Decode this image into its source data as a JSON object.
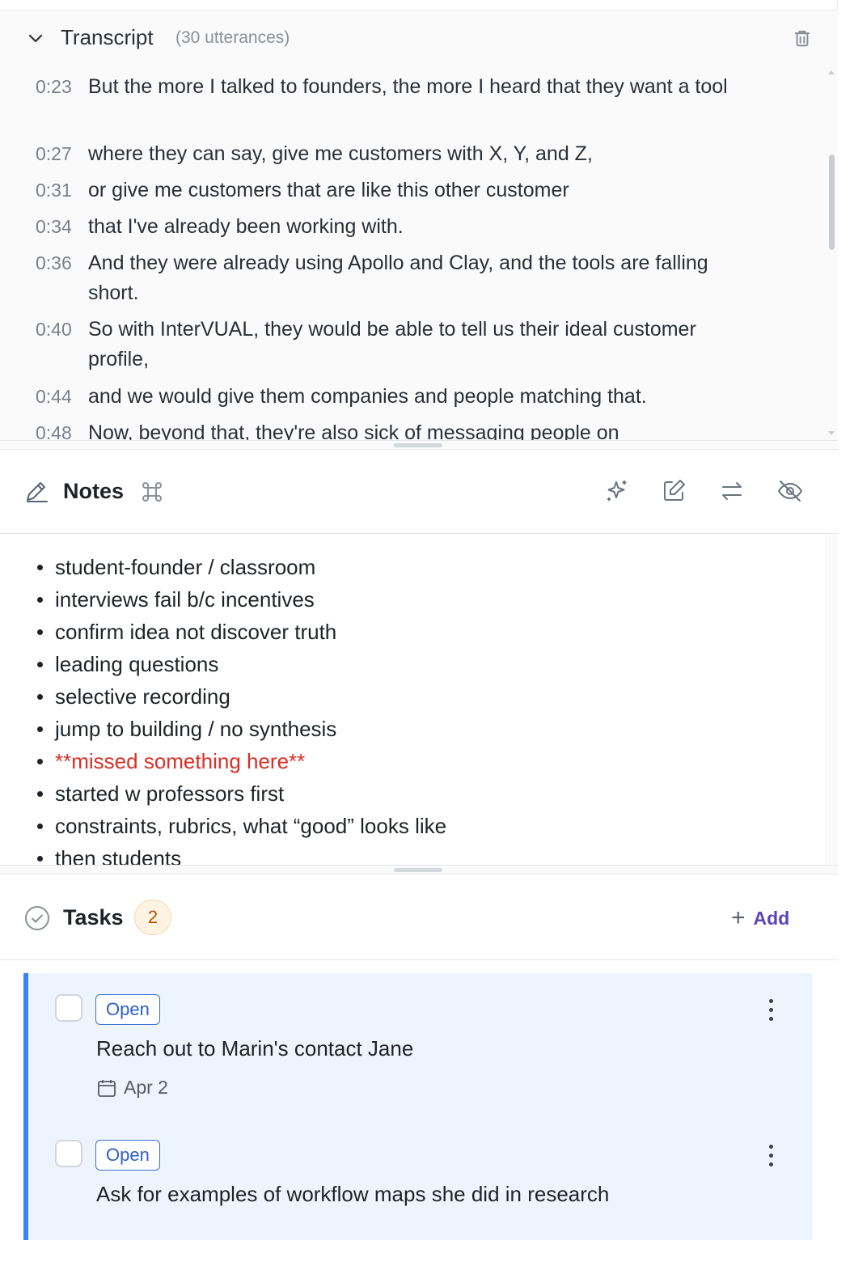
{
  "transcript": {
    "title": "Transcript",
    "count": "(30 utterances)",
    "utterances": [
      {
        "time": "0:23",
        "text": "But the more I talked to founders, the more I heard that they want a tool"
      },
      {
        "time": "0:27",
        "text": "where they can say, give me customers with X, Y, and Z,"
      },
      {
        "time": "0:31",
        "text": "or give me customers that are like this other customer"
      },
      {
        "time": "0:34",
        "text": "that I've already been working with."
      },
      {
        "time": "0:36",
        "text": "And they were already using Apollo and Clay, and the tools are falling short."
      },
      {
        "time": "0:40",
        "text": "So with InterVUAL, they would be able to tell us their ideal customer profile,"
      },
      {
        "time": "0:44",
        "text": "and we would give them companies and people matching that."
      },
      {
        "time": "0:48",
        "text": "Now, beyond that, they're also sick of messaging people on"
      }
    ],
    "icons": {
      "collapse": "chevron-down-icon",
      "delete": "trash-icon"
    }
  },
  "notes": {
    "title": "Notes",
    "icons": {
      "shortcut": "command-icon",
      "ai": "sparkle-icon",
      "edit": "edit-icon",
      "swap": "swap-icon",
      "hide": "eye-off-icon"
    },
    "items": [
      {
        "text": "student-founder / classroom",
        "highlight": false
      },
      {
        "text": "interviews fail b/c incentives",
        "highlight": false
      },
      {
        "text": "confirm idea not discover truth",
        "highlight": false
      },
      {
        "text": "leading questions",
        "highlight": false
      },
      {
        "text": "selective recording",
        "highlight": false
      },
      {
        "text": "jump to building / no synthesis",
        "highlight": false
      },
      {
        "text": "**missed something here**",
        "highlight": true
      },
      {
        "text": "started w professors first",
        "highlight": false
      },
      {
        "text": "constraints, rubrics, what “good” looks like",
        "highlight": false
      },
      {
        "text": "then students",
        "highlight": false
      }
    ],
    "highlight_color": "#d93025"
  },
  "tasks": {
    "title": "Tasks",
    "count": "2",
    "add_label": "Add",
    "accent_color": "#3b82f6",
    "items": [
      {
        "status": "Open",
        "title": "Reach out to Marin's contact Jane",
        "due": "Apr 2"
      },
      {
        "status": "Open",
        "title": "Ask for examples of workflow maps she did in research",
        "due": ""
      }
    ]
  }
}
